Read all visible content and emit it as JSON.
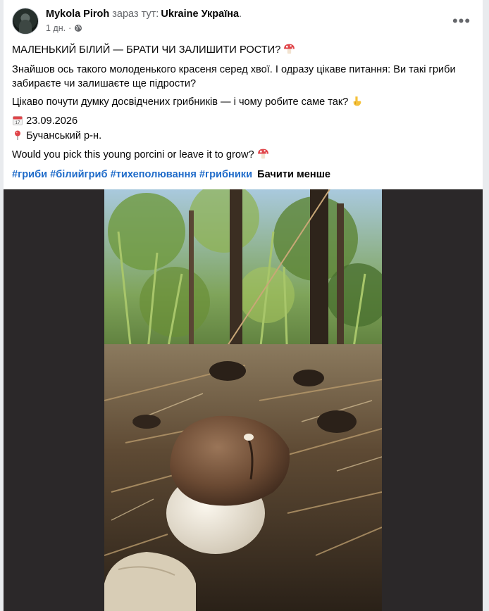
{
  "post": {
    "author": "Mykola Piroh",
    "at_text": "зараз тут:",
    "place": "Ukraine Україна",
    "place_suffix": ".",
    "time": "1 дн.",
    "separator": "·",
    "privacy_icon": "globe-icon",
    "more_label": "•••"
  },
  "text": {
    "title": "МАЛЕНЬКИЙ БІЛИЙ — БРАТИ ЧИ ЗАЛИШИТИ РОСТИ?",
    "body": "Знайшов ось такого молоденького красеня серед хвої. І одразу цікаве питання: Ви такі гриби забираєте чи залишаєте ще підрости?",
    "question": "Цікаво почути думку досвідчених грибників — і чому робите саме так?",
    "date": "23.09.2026",
    "location": "Бучанський р-н.",
    "english": "Would you pick this young porcini or leave it to grow?",
    "hashtags": [
      "#гриби",
      "#білийгриб",
      "#тихеполювання",
      "#грибники"
    ],
    "see_less": "Бачити менше"
  },
  "icons": {
    "mushroom": "mushroom-emoji",
    "pointing": "pointing-down-emoji",
    "calendar": "calendar-emoji",
    "pin": "location-pin-emoji"
  },
  "colors": {
    "link": "#1f6bc9",
    "secondary": "#65676b",
    "media_bg": "#2b2829"
  }
}
